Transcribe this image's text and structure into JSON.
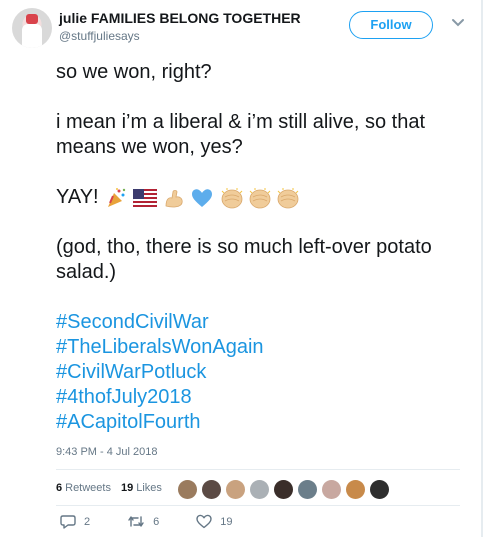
{
  "author": {
    "name": "julie FAMILIES BELONG TOGETHER",
    "handle": "@stuffjuliesays"
  },
  "follow_label": "Follow",
  "tweet": {
    "line1": "so we won, right?",
    "line2": "i mean i’m a liberal & i’m still alive, so that means we won, yes?",
    "yay": "YAY!",
    "line4": "(god, tho, there is so much left-over potato salad.)",
    "hashtags": [
      "#SecondCivilWar",
      "#TheLiberalsWonAgain",
      "#CivilWarPotluck",
      "#4thofJuly2018",
      "#ACapitolFourth"
    ]
  },
  "emojis": [
    "party-popper",
    "us-flag",
    "flexed-bicep",
    "blue-heart",
    "clapping-hands",
    "clapping-hands",
    "clapping-hands"
  ],
  "timestamp": "9:43 PM - 4 Jul 2018",
  "stats": {
    "retweets_count": "6",
    "retweets_label": "Retweets",
    "likes_count": "19",
    "likes_label": "Likes"
  },
  "likers": [
    "#9a7b5e",
    "#5b4a44",
    "#c9a27f",
    "#aab0b5",
    "#3a2e2a",
    "#6b7e8a",
    "#c8a8a0",
    "#c88a4a",
    "#2e2e2e"
  ],
  "actions": {
    "replies": "2",
    "retweets": "6",
    "likes": "19"
  },
  "colors": {
    "link": "#1b95e0",
    "follow": "#1da1f2",
    "muted": "#657786"
  }
}
